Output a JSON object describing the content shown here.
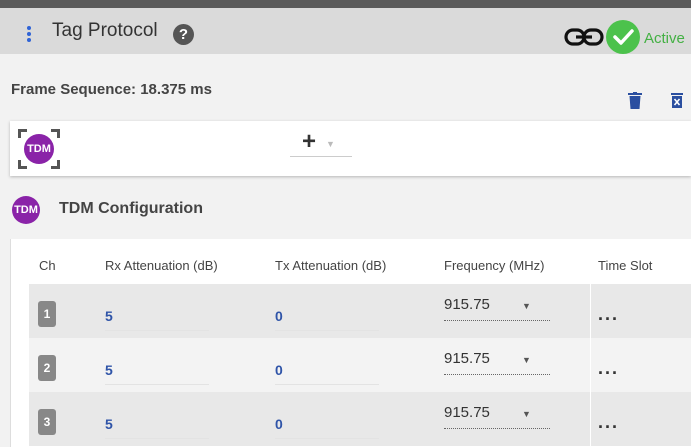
{
  "header": {
    "title": "Tag Protocol",
    "help_label": "?",
    "status_label": "Active",
    "status_color": "#4cc24c"
  },
  "frame": {
    "sequence_label": "Frame Sequence: 18.375 ms"
  },
  "tag_row": {
    "badge_label": "TDM",
    "add_label": "+"
  },
  "section": {
    "badge_label": "TDM",
    "title": "TDM Configuration"
  },
  "table": {
    "columns": [
      "Ch",
      "Rx Attenuation (dB)",
      "Tx Attenuation (dB)",
      "Frequency (MHz)",
      "Time Slot"
    ],
    "rows": [
      {
        "ch": "1",
        "rx": "5",
        "tx": "0",
        "freq": "915.75",
        "slot": "..."
      },
      {
        "ch": "2",
        "rx": "5",
        "tx": "0",
        "freq": "915.75",
        "slot": "..."
      },
      {
        "ch": "3",
        "rx": "5",
        "tx": "0",
        "freq": "915.75",
        "slot": "..."
      }
    ]
  },
  "icons": {
    "menu": "kebab-menu-icon",
    "help": "question-circle-icon",
    "link": "link-icon",
    "status": "check-circle-icon",
    "delete": "trash-icon",
    "delete_all": "delete-box-icon",
    "select": "select-corners-icon",
    "add": "plus-icon",
    "dropdown": "caret-down-icon"
  },
  "colors": {
    "accent_purple": "#8a23a8",
    "value_blue": "#2f54a8",
    "menu_blue": "#2f63d6"
  }
}
